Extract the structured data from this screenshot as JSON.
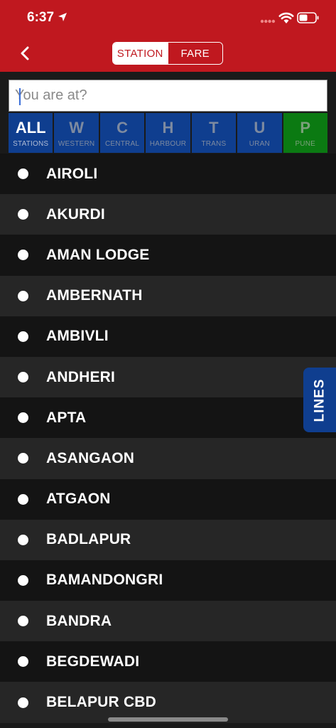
{
  "status_bar": {
    "time": "6:37"
  },
  "nav": {
    "tabs": [
      "STATION",
      "FARE"
    ],
    "active_tab": "STATION"
  },
  "search": {
    "placeholder": "You are at?",
    "value": ""
  },
  "line_filters": [
    {
      "letter": "ALL",
      "label": "STATIONS",
      "color": "#0f3e8f"
    },
    {
      "letter": "W",
      "label": "WESTERN",
      "color": "#0f3e8f"
    },
    {
      "letter": "C",
      "label": "CENTRAL",
      "color": "#0f3e8f"
    },
    {
      "letter": "H",
      "label": "HARBOUR",
      "color": "#0f3e8f"
    },
    {
      "letter": "T",
      "label": "TRANS",
      "color": "#0f3e8f"
    },
    {
      "letter": "U",
      "label": "URAN",
      "color": "#0f3e8f"
    },
    {
      "letter": "P",
      "label": "PUNE",
      "color": "#0b7a12"
    }
  ],
  "stations": [
    "AIROLI",
    "AKURDI",
    "AMAN LODGE",
    "AMBERNATH",
    "AMBIVLI",
    "ANDHERI",
    "APTA",
    "ASANGAON",
    "ATGAON",
    "BADLAPUR",
    "BAMANDONGRI",
    "BANDRA",
    "BEGDEWADI",
    "BELAPUR CBD"
  ],
  "side_button": {
    "label": "LINES"
  },
  "colors": {
    "header": "#c0181f",
    "line_blue": "#0f3e8f",
    "line_green": "#0b7a12"
  }
}
